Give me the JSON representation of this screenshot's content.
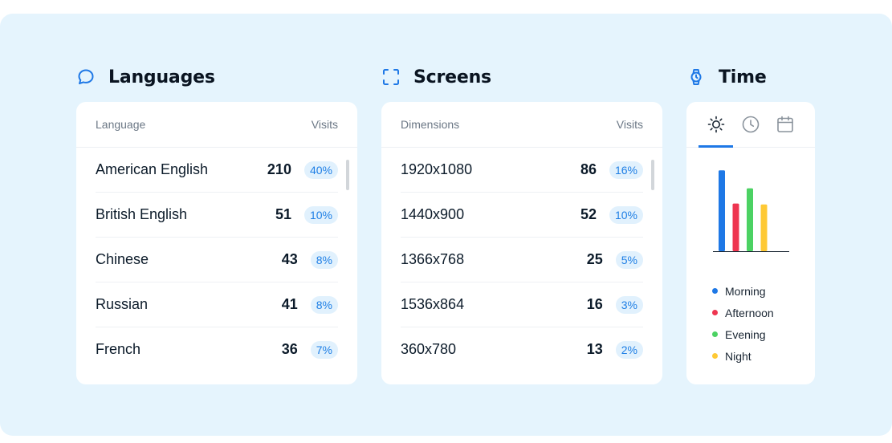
{
  "languages": {
    "title": "Languages",
    "col_left": "Language",
    "col_right": "Visits",
    "rows": [
      {
        "name": "American English",
        "visits": "210",
        "pct": "40%"
      },
      {
        "name": "British English",
        "visits": "51",
        "pct": "10%"
      },
      {
        "name": "Chinese",
        "visits": "43",
        "pct": "8%"
      },
      {
        "name": "Russian",
        "visits": "41",
        "pct": "8%"
      },
      {
        "name": "French",
        "visits": "36",
        "pct": "7%"
      }
    ]
  },
  "screens": {
    "title": "Screens",
    "col_left": "Dimensions",
    "col_right": "Visits",
    "rows": [
      {
        "name": "1920x1080",
        "visits": "86",
        "pct": "16%"
      },
      {
        "name": "1440x900",
        "visits": "52",
        "pct": "10%"
      },
      {
        "name": "1366x768",
        "visits": "25",
        "pct": "5%"
      },
      {
        "name": "1536x864",
        "visits": "16",
        "pct": "3%"
      },
      {
        "name": "360x780",
        "visits": "13",
        "pct": "2%"
      }
    ]
  },
  "time": {
    "title": "Time",
    "tabs": [
      {
        "icon": "sun-icon",
        "active": true
      },
      {
        "icon": "clock-icon",
        "active": false
      },
      {
        "icon": "calendar-icon",
        "active": false
      }
    ]
  },
  "chart_data": {
    "type": "bar",
    "categories": [
      "Morning",
      "Afternoon",
      "Evening",
      "Night"
    ],
    "values": [
      90,
      53,
      70,
      52
    ],
    "colors": [
      "#1e78e6",
      "#ee3550",
      "#4cd263",
      "#fec935"
    ],
    "ylim": [
      0,
      100
    ],
    "grid": false,
    "legend": "bottom"
  },
  "colors": {
    "accent": "#1e78e6",
    "background": "#e5f4fd",
    "badge_bg": "#e1f1fd",
    "badge_text": "#1f7fe5"
  }
}
